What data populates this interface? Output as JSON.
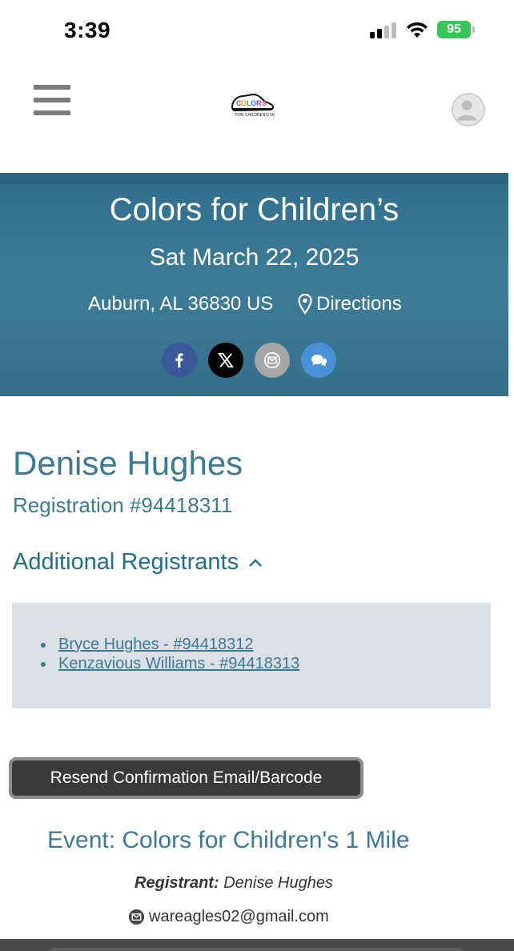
{
  "status_bar": {
    "time": "3:39",
    "battery": "95"
  },
  "header": {
    "menu_icon": "hamburger-menu-icon",
    "logo_alt": "COLORS FOR CHILDREN'S 5K",
    "avatar_icon": "user-avatar-icon"
  },
  "hero": {
    "title": "Colors for Children’s",
    "date": "Sat March 22, 2025",
    "location": "Auburn, AL 36830 US",
    "directions_label": "Directions",
    "share": [
      {
        "icon": "facebook-icon",
        "color": "#3b5998"
      },
      {
        "icon": "x-icon",
        "color": "#000000"
      },
      {
        "icon": "email-icon",
        "color": "#a7a7a7"
      },
      {
        "icon": "sms-icon",
        "color": "#4a90d9"
      }
    ],
    "background_color": "#3a7793"
  },
  "registration": {
    "name": "Denise Hughes",
    "number_label": "Registration #94418311",
    "additional_label": "Additional Registrants",
    "additional": [
      {
        "label": "Bryce Hughes - #94418312"
      },
      {
        "label": "Kenzavious Williams - #94418313"
      }
    ],
    "resend_button": "Resend Confirmation Email/Barcode"
  },
  "event": {
    "title": "Event: Colors for Children's 1 Mile",
    "registrant_label": "Registrant:",
    "registrant_name": "Denise Hughes",
    "email": "wareagles02@gmail.com"
  },
  "colors": {
    "accent": "#3b7a96",
    "link": "#1f6f8b"
  }
}
